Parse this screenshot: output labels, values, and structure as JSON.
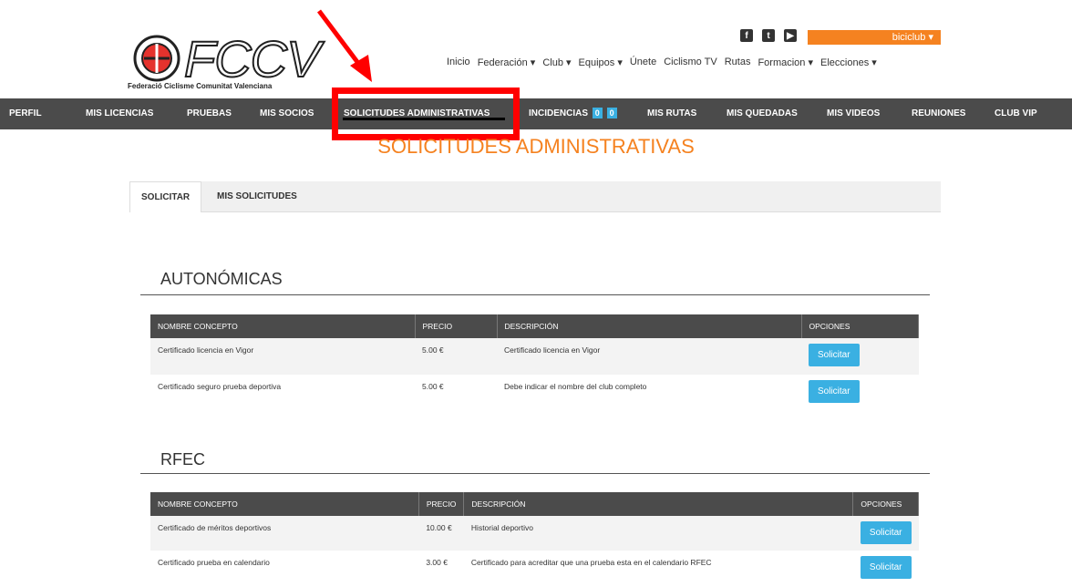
{
  "brand": {
    "logo_text": "FCCV",
    "logo_subtitle": "Federació Ciclisme Comunitat Valenciana"
  },
  "social": {
    "facebook": "f",
    "twitter": "t",
    "youtube": "▶"
  },
  "user_menu": {
    "label": "biciclub ▾"
  },
  "top_nav": {
    "items": [
      "Inicio",
      "Federación ▾",
      "Club ▾",
      "Equipos ▾",
      "Únete",
      "Ciclismo TV",
      "Rutas",
      "Formacion ▾",
      "Elecciones ▾"
    ]
  },
  "main_nav": {
    "perfil": "PERFIL",
    "licencias": "MIS LICENCIAS",
    "pruebas": "PRUEBAS",
    "socios": "MIS SOCIOS",
    "solicitudes": "SOLICITUDES ADMINISTRATIVAS",
    "incidencias": "INCIDENCIAS",
    "incidencias_badge_1": "0",
    "incidencias_badge_2": "0",
    "rutas": "MIS RUTAS",
    "quedadas": "MIS QUEDADAS",
    "videos": "MIS VIDEOS",
    "reuniones": "REUNIONES",
    "clubvip": "CLUB VIP"
  },
  "page_title": "SOLICITUDES ADMINISTRATIVAS",
  "tabs": {
    "solicitar": "SOLICITAR",
    "mis_solicitudes": "MIS SOLICITUDES"
  },
  "autonomicas": {
    "title": "AUTONÓMICAS",
    "headers": {
      "concepto": "NOMBRE CONCEPTO",
      "precio": "PRECIO",
      "descripcion": "DESCRIPCIÓN",
      "opciones": "OPCIONES"
    },
    "rows": [
      {
        "concepto": "Certificado licencia en Vigor",
        "precio": "5.00 €",
        "descripcion": "Certificado licencia en Vigor",
        "button": "Solicitar"
      },
      {
        "concepto": "Certificado seguro prueba deportiva",
        "precio": "5.00 €",
        "descripcion": "Debe indicar el nombre del club completo",
        "button": "Solicitar"
      }
    ]
  },
  "rfec": {
    "title": "RFEC",
    "headers": {
      "concepto": "NOMBRE CONCEPTO",
      "precio": "PRECIO",
      "descripcion": "DESCRIPCIÓN",
      "opciones": "OPCIONES"
    },
    "rows": [
      {
        "concepto": "Certificado de méritos deportivos",
        "precio": "10.00 €",
        "descripcion": "Historial deportivo",
        "button": "Solicitar"
      },
      {
        "concepto": "Certificado prueba en calendario",
        "precio": "3.00 €",
        "descripcion": "Certificado para acreditar que una prueba esta en el calendario RFEC",
        "button": "Solicitar"
      }
    ]
  }
}
